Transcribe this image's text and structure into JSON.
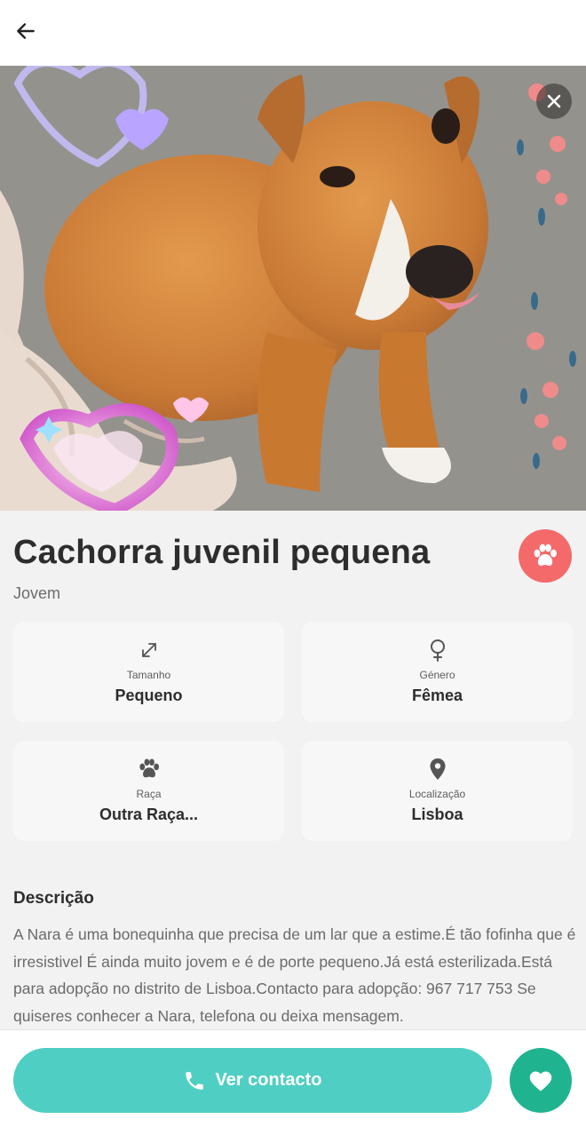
{
  "header": {
    "back_icon": "arrow-left-icon"
  },
  "photo": {
    "close_icon": "close-icon"
  },
  "pet": {
    "name": "Cachorra juvenil pequena",
    "age": "Jovem",
    "badge_icon": "paw-icon",
    "badge_color": "#f46a6a"
  },
  "attributes": [
    {
      "icon": "resize-arrows-icon",
      "label": "Tamanho",
      "value": "Pequeno"
    },
    {
      "icon": "female-symbol-icon",
      "label": "Género",
      "value": "Fêmea"
    },
    {
      "icon": "paw-icon",
      "label": "Raça",
      "value": "Outra Raça..."
    },
    {
      "icon": "location-pin-icon",
      "label": "Localização",
      "value": "Lisboa"
    }
  ],
  "description": {
    "title": "Descrição",
    "text": "A Nara é uma bonequinha que precisa de um lar que a estime.É tão fofinha que é irresistivel É ainda muito jovem e é de porte pequeno.Já está esterilizada.Está para adopção no distrito de Lisboa.Contacto para adopção: 967 717 753 Se quiseres conhecer a Nara, telefona ou deixa mensagem."
  },
  "actions": {
    "contact_label": "Ver contacto",
    "contact_color": "#4fcfc3",
    "favorite_color": "#1fb48f"
  }
}
